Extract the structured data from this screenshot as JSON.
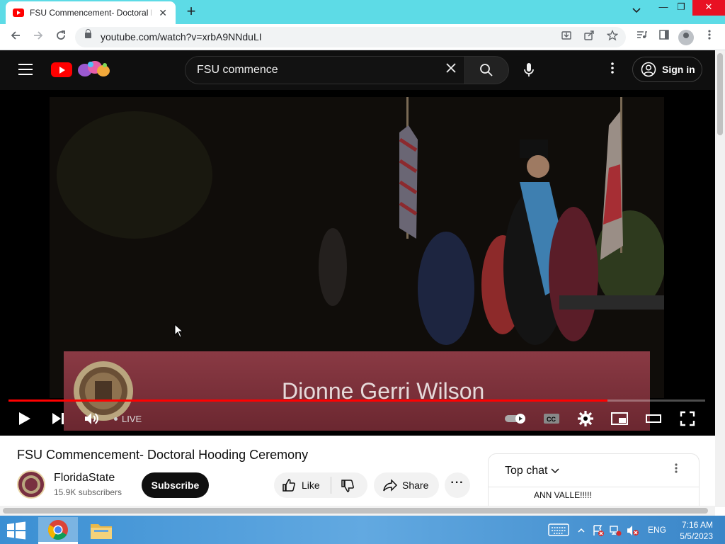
{
  "browser": {
    "tab_title": "FSU Commencement- Doctoral Hooding Ceremony",
    "tab_close": "✕",
    "new_tab": "+",
    "url": "youtube.com/watch?v=xrbA9NNduLI",
    "window_controls": {
      "minimize": "—",
      "restore": "❐",
      "close": "✕"
    }
  },
  "youtube": {
    "search_value": "FSU commence",
    "sign_in_label": "Sign in"
  },
  "player": {
    "lower_third_name": "Dionne Gerri Wilson",
    "live_label": "LIVE",
    "progress_fraction": 0.86
  },
  "video": {
    "title": "FSU Commencement- Doctoral Hooding Ceremony",
    "channel_name": "FloridaState",
    "subscribers": "15.9K subscribers",
    "subscribe_label": "Subscribe",
    "like_label": "Like",
    "share_label": "Share",
    "more_label": "···"
  },
  "chat": {
    "title": "Top chat",
    "message": "ANN VALLE!!!!!"
  },
  "taskbar": {
    "language": "ENG",
    "time": "7:16 AM",
    "date": "5/5/2023"
  },
  "colors": {
    "accent_red": "#ff0000",
    "fsu_garnet": "#782f40",
    "taskbar_blue": "#3b8fd3",
    "tabstrip_cyan": "#5ddbe6"
  }
}
